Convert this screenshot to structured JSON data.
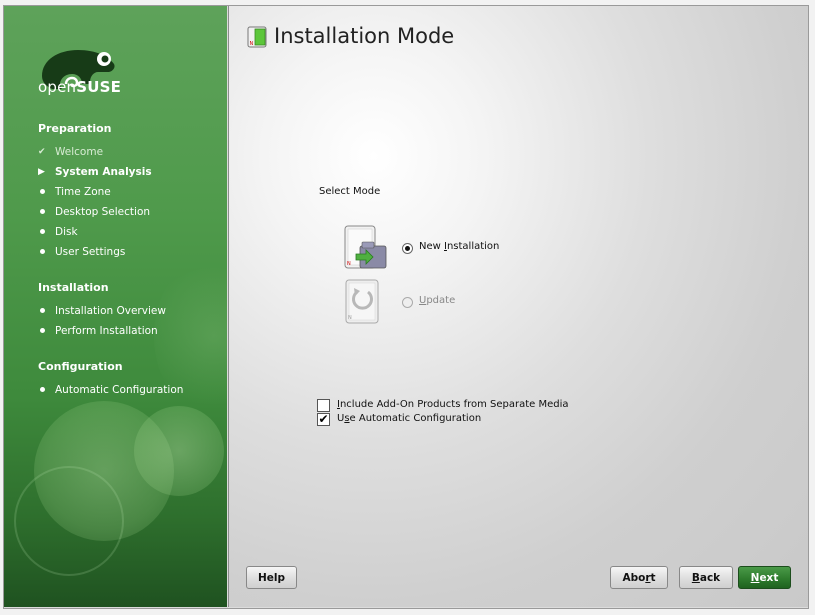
{
  "sidebar": {
    "logo_prefix": "open",
    "logo_suffix": "SUSE",
    "sections": [
      {
        "title": "Preparation"
      },
      {
        "title": "Installation"
      },
      {
        "title": "Configuration"
      }
    ],
    "steps": {
      "welcome": "Welcome",
      "system_analysis": "System Analysis",
      "time_zone": "Time Zone",
      "desktop_selection": "Desktop Selection",
      "disk": "Disk",
      "user_settings": "User Settings",
      "installation_overview": "Installation Overview",
      "perform_installation": "Perform Installation",
      "automatic_configuration": "Automatic Configuration"
    }
  },
  "main": {
    "title": "Installation Mode",
    "select_mode_label": "Select Mode",
    "new_installation": {
      "pre": "New ",
      "key": "I",
      "post": "nstallation"
    },
    "update": {
      "pre": "",
      "key": "U",
      "post": "pdate"
    },
    "addon": {
      "pre": "",
      "key": "I",
      "post": "nclude Add-On Products from Separate Media"
    },
    "auto_config": {
      "pre": "U",
      "key": "s",
      "post": "e Automatic Configuration"
    }
  },
  "buttons": {
    "help": "Help",
    "abort": {
      "pre": "Abo",
      "key": "r",
      "post": "t"
    },
    "back": {
      "pre": "",
      "key": "B",
      "post": "ack"
    },
    "next": {
      "pre": "",
      "key": "N",
      "post": "ext"
    }
  },
  "colors": {
    "accent_green": "#2f7c2e",
    "sidebar_green": "#4f9a4b"
  }
}
